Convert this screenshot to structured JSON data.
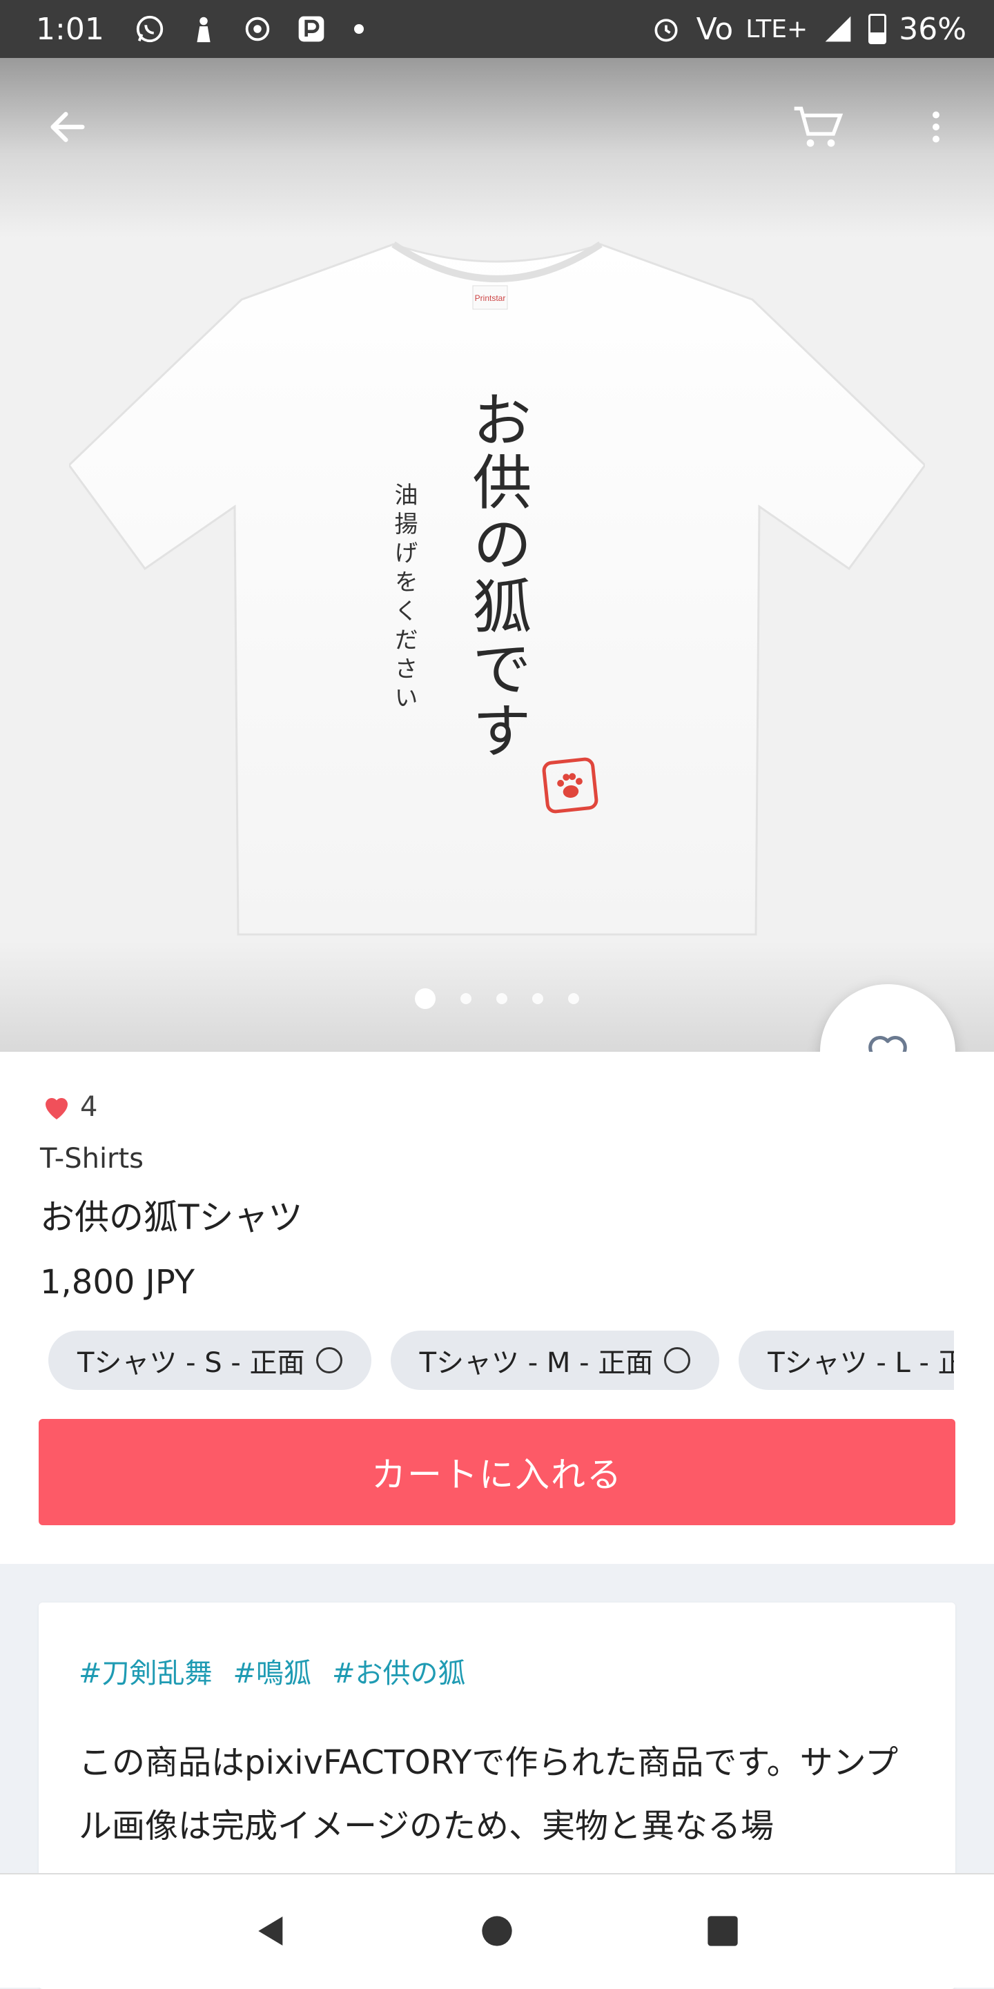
{
  "status_bar": {
    "time": "1:01",
    "battery": "36%",
    "network": "LTE+",
    "volte": "Vo",
    "left_icons": [
      "whatsapp-icon",
      "app-figure-icon",
      "app-emblem-icon",
      "pixiv-icon",
      "dot-icon"
    ],
    "right_icons": [
      "alarm-icon",
      "volte-icon",
      "signal-icon",
      "battery-icon"
    ]
  },
  "app_bar": {
    "icons": [
      "back-arrow-icon",
      "cart-icon",
      "more-vert-icon"
    ]
  },
  "product_image": {
    "shirt_main_text": "お供の狐です",
    "shirt_sub_text": "油揚げをください",
    "stamp_icon": "paw-icon",
    "shirt_tag_text": "Printstar",
    "carousel_count": 5,
    "carousel_active": 0
  },
  "product": {
    "like_count": "4",
    "category": "T-Shirts",
    "title": "お供の狐Tシャツ",
    "price": "1,800 JPY",
    "variants": [
      {
        "label": "Tシャツ - S - 正面"
      },
      {
        "label": "Tシャツ - M - 正面"
      },
      {
        "label": "Tシャツ - L - 正面"
      }
    ],
    "add_to_cart": "カートに入れる"
  },
  "description": {
    "tags": [
      "#刀剣乱舞",
      "#鳴狐",
      "#お供の狐"
    ],
    "text": "この商品はpixivFACTORYで作られた商品です。サンプル画像は完成イメージのため、実物と異なる場"
  },
  "colors": {
    "accent": "#fd5a67",
    "tag": "#1f9bb3",
    "heart": "#f0505a",
    "status_bar": "#3c3c3c"
  },
  "nav_bar": {
    "icons": [
      "nav-back-icon",
      "nav-home-icon",
      "nav-recents-icon"
    ]
  }
}
